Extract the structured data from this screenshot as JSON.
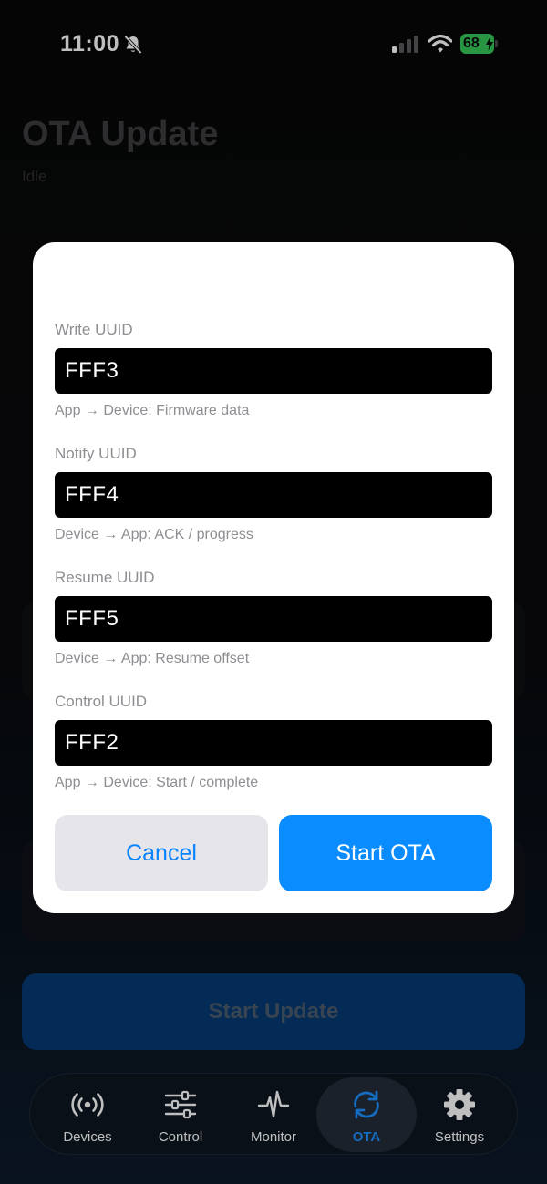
{
  "status_bar": {
    "time": "11:00",
    "battery": "68"
  },
  "page": {
    "title": "OTA Update",
    "status": "Idle",
    "primary_button": "Start Update"
  },
  "tabs": [
    {
      "label": "Devices",
      "icon": "antenna-radiowaves-icon",
      "active": false
    },
    {
      "label": "Control",
      "icon": "sliders-icon",
      "active": false
    },
    {
      "label": "Monitor",
      "icon": "waveform-icon",
      "active": false
    },
    {
      "label": "OTA",
      "icon": "sync-arrows-icon",
      "active": true
    },
    {
      "label": "Settings",
      "icon": "gear-icon",
      "active": false
    }
  ],
  "modal": {
    "fields": [
      {
        "label": "Write UUID",
        "value": "FFF3",
        "help": "App → Device: Firmware data"
      },
      {
        "label": "Notify UUID",
        "value": "FFF4",
        "help": "Device → App: ACK / progress"
      },
      {
        "label": "Resume UUID",
        "value": "FFF5",
        "help": "Device → App: Resume offset"
      },
      {
        "label": "Control UUID",
        "value": "FFF2",
        "help": "App → Device: Start / complete"
      }
    ],
    "cancel_label": "Cancel",
    "confirm_label": "Start OTA"
  },
  "colors": {
    "accent": "#0a8cff",
    "battery": "#34c759",
    "tab_active": "#1e90ff"
  }
}
